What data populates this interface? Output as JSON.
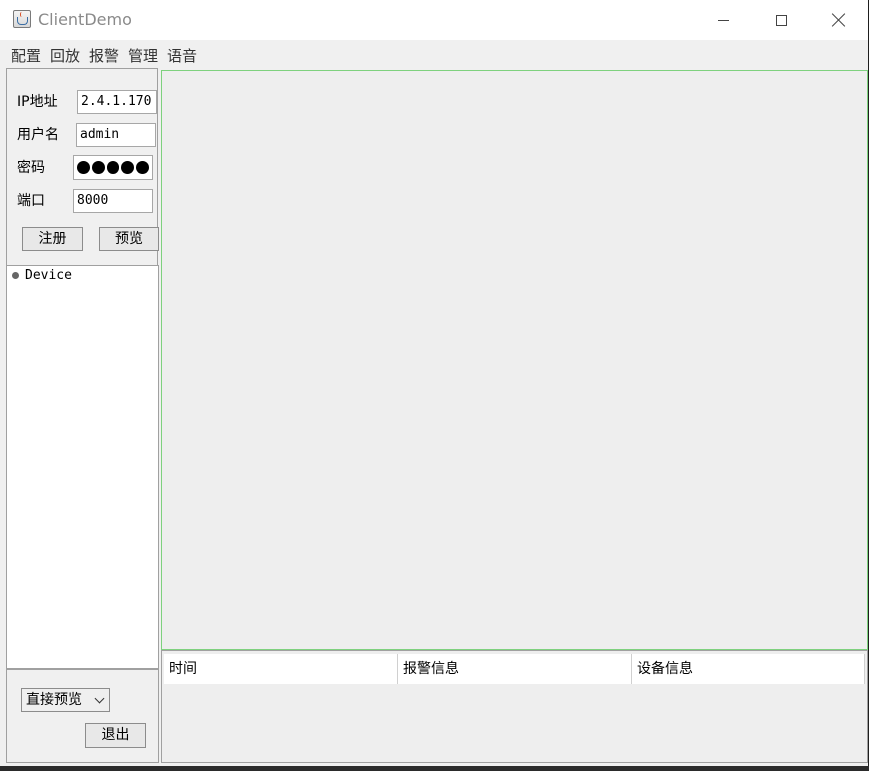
{
  "window": {
    "title": "ClientDemo"
  },
  "menu": {
    "items": [
      "配置",
      "回放",
      "报警",
      "管理",
      "语音"
    ]
  },
  "login": {
    "ip_label": "IP地址",
    "ip_value": "2.4.1.170",
    "user_label": "用户名",
    "user_value": "admin",
    "password_label": "密码",
    "password_masked": "●●●●●",
    "port_label": "端口",
    "port_value": "8000",
    "register_label": "注册",
    "preview_label": "预览"
  },
  "tree": {
    "root_label": "Device"
  },
  "bottom": {
    "mode_selected": "直接预览",
    "exit_label": "退出"
  },
  "alarm_table": {
    "columns": [
      "时间",
      "报警信息",
      "设备信息"
    ]
  },
  "colors": {
    "video_border": "#7ed17e",
    "window_bg": "#f0f0f0"
  }
}
